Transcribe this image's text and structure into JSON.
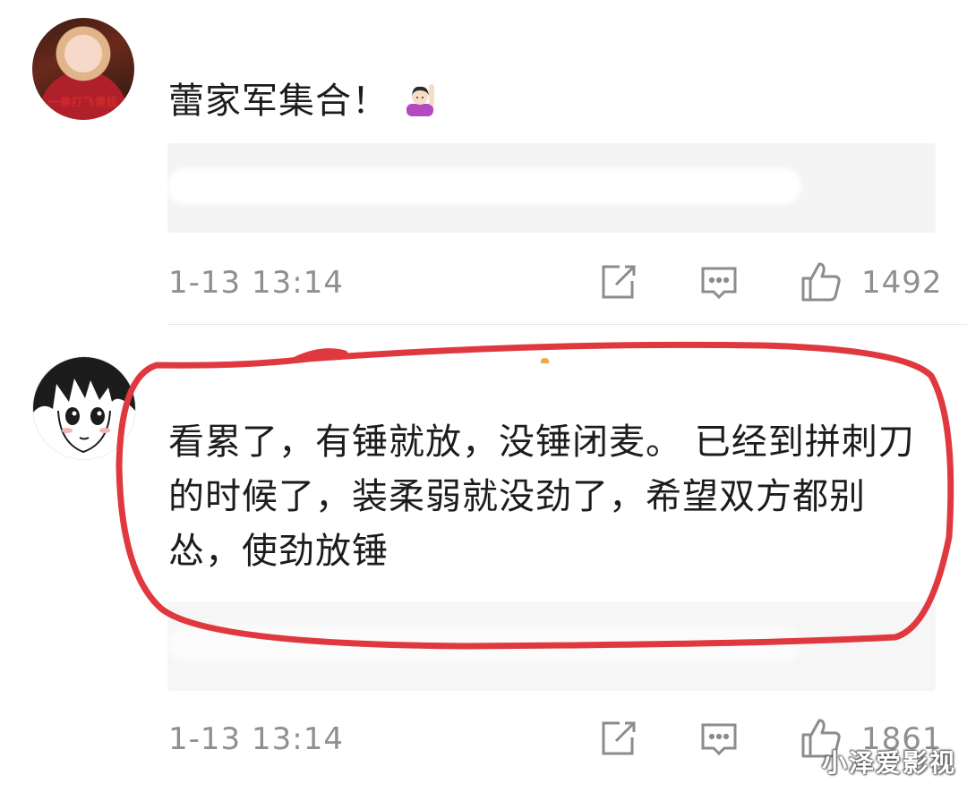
{
  "comments": [
    {
      "avatar_caption": "一拳打飞傻妞",
      "text": "蕾家军集合！",
      "emoji": "raise-hand-emoji",
      "timestamp": "1-13 13:14",
      "like_count": "1492"
    },
    {
      "text": "看累了，有锤就放，没锤闭麦。 已经到拼刺刀的时候了，装柔弱就没劲了，希望双方都别怂，使劲放锤",
      "timestamp": "1-13 13:14",
      "like_count": "1861"
    }
  ],
  "annotation": {
    "highlight_color": "#e0383f"
  },
  "watermark": {
    "text": "小泽爱影视"
  },
  "colors": {
    "meta_text": "#8f8f8f",
    "card_bg": "#f4f4f4",
    "icon_stroke": "#8c8c8c"
  }
}
